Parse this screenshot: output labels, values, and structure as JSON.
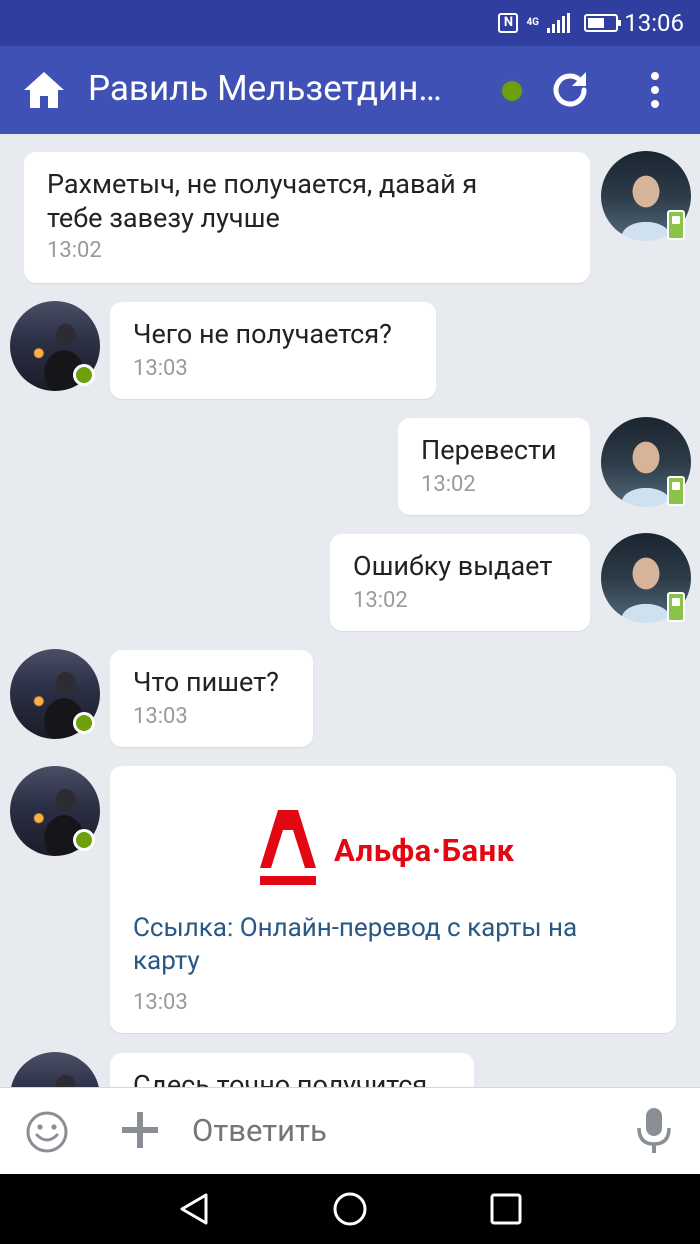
{
  "status_bar": {
    "time": "13:06",
    "network": "4G",
    "battery_level": 0.6
  },
  "app_bar": {
    "title": "Равиль Мельзетдин…",
    "online": true,
    "accent_color": "#3f51b5"
  },
  "messages": [
    {
      "side": "right",
      "lines": [
        "Рахметыч, не получается, давай я",
        "тебе завезу лучше"
      ],
      "time": "13:02",
      "badge": "phone"
    },
    {
      "side": "left",
      "lines": [
        "Чего не получается?"
      ],
      "time": "13:03",
      "badge": "online"
    },
    {
      "side": "right",
      "lines": [
        "Перевести"
      ],
      "time": "13:02",
      "badge": "phone"
    },
    {
      "side": "right",
      "lines": [
        "Ошибку выдает"
      ],
      "time": "13:02",
      "badge": "phone"
    },
    {
      "side": "left",
      "lines": [
        "Что пишет?"
      ],
      "time": "13:03",
      "badge": "online"
    },
    {
      "side": "left",
      "type": "link",
      "logo_text": "Альфа·Банк",
      "link_lines": [
        "Ссылка: Онлайн-перевод с карты на",
        "карту"
      ],
      "time": "13:03",
      "badge": "online"
    },
    {
      "side": "left",
      "lines": [
        "Сдесь точно получится"
      ],
      "time": "",
      "badge": "online"
    }
  ],
  "composer": {
    "placeholder": "Ответить"
  }
}
